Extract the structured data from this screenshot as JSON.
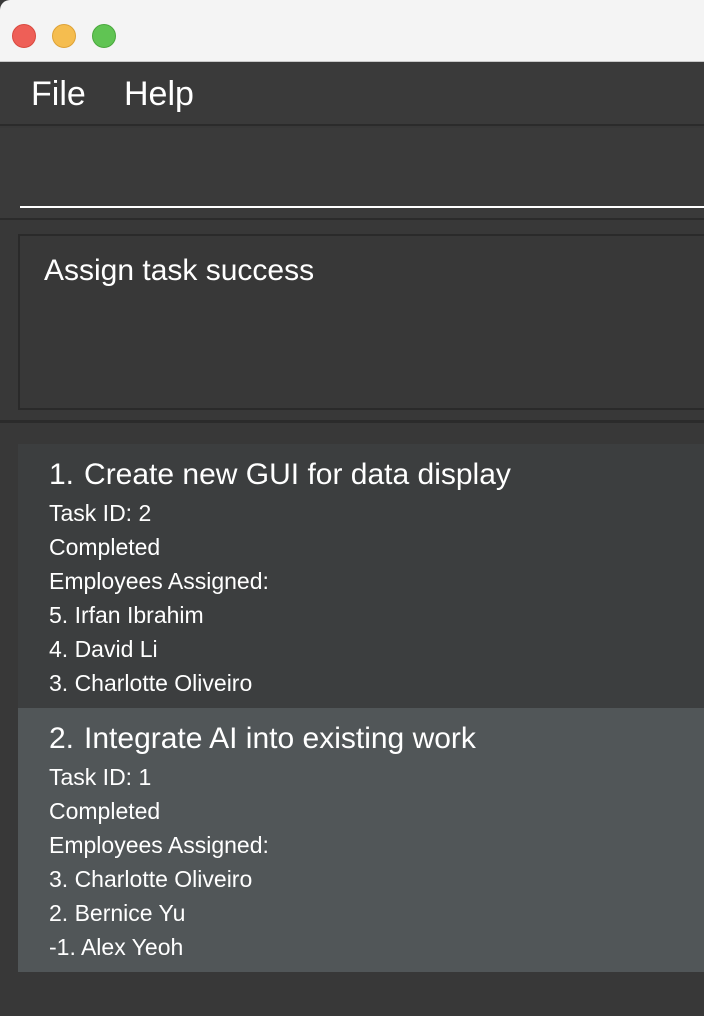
{
  "window": {
    "title": ""
  },
  "menu": {
    "items": [
      {
        "label": "File"
      },
      {
        "label": "Help"
      }
    ]
  },
  "command": {
    "value": "",
    "placeholder": ""
  },
  "result": {
    "message": "Assign task success"
  },
  "tasks": [
    {
      "index": "1.",
      "title": "Create new GUI for data display",
      "task_id": "Task ID: 2",
      "status": "Completed",
      "employees_header": "Employees Assigned:",
      "employees": [
        "5. Irfan Ibrahim",
        "4. David Li",
        "3. Charlotte Oliveiro"
      ]
    },
    {
      "index": "2.",
      "title": "Integrate AI into existing work",
      "task_id": "Task ID: 1",
      "status": "Completed",
      "employees_header": "Employees Assigned:",
      "employees": [
        "3. Charlotte Oliveiro",
        "2. Bernice Yu",
        "-1. Alex Yeoh"
      ]
    }
  ],
  "colors": {
    "background": "#383838",
    "card_odd": "#3c3e3f",
    "card_even": "#515658",
    "text": "#ffffff"
  }
}
